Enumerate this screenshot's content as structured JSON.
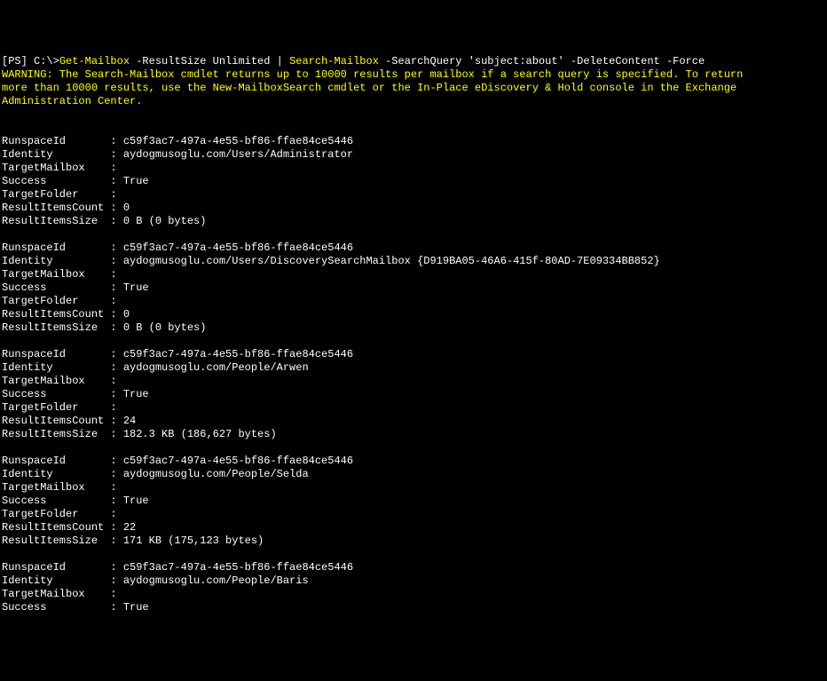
{
  "prompt_prefix": "[PS] C:\\>",
  "cmd1": "Get-Mailbox",
  "cmd_args1": " -ResultSize Unlimited | ",
  "cmd2": "Search-Mailbox",
  "cmd_args2": " -SearchQuery 'subject:about' -DeleteContent -Force",
  "warning_l1": "WARNING: The Search-Mailbox cmdlet returns up to 10000 results per mailbox if a search query is specified. To return",
  "warning_l2": "more than 10000 results, use the New-MailboxSearch cmdlet or the In-Place eDiscovery & Hold console in the Exchange",
  "warning_l3": "Administration Center.",
  "records": [
    {
      "RunspaceId": "c59f3ac7-497a-4e55-bf86-ffae84ce5446",
      "Identity": "aydogmusoglu.com/Users/Administrator",
      "TargetMailbox": "",
      "Success": "True",
      "TargetFolder": "",
      "ResultItemsCount": "0",
      "ResultItemsSize": "0 B (0 bytes)"
    },
    {
      "RunspaceId": "c59f3ac7-497a-4e55-bf86-ffae84ce5446",
      "Identity": "aydogmusoglu.com/Users/DiscoverySearchMailbox {D919BA05-46A6-415f-80AD-7E09334BB852}",
      "TargetMailbox": "",
      "Success": "True",
      "TargetFolder": "",
      "ResultItemsCount": "0",
      "ResultItemsSize": "0 B (0 bytes)"
    },
    {
      "RunspaceId": "c59f3ac7-497a-4e55-bf86-ffae84ce5446",
      "Identity": "aydogmusoglu.com/People/Arwen",
      "TargetMailbox": "",
      "Success": "True",
      "TargetFolder": "",
      "ResultItemsCount": "24",
      "ResultItemsSize": "182.3 KB (186,627 bytes)"
    },
    {
      "RunspaceId": "c59f3ac7-497a-4e55-bf86-ffae84ce5446",
      "Identity": "aydogmusoglu.com/People/Selda",
      "TargetMailbox": "",
      "Success": "True",
      "TargetFolder": "",
      "ResultItemsCount": "22",
      "ResultItemsSize": "171 KB (175,123 bytes)"
    }
  ],
  "partial": {
    "RunspaceId": "c59f3ac7-497a-4e55-bf86-ffae84ce5446",
    "Identity": "aydogmusoglu.com/People/Baris",
    "TargetMailbox": "",
    "Success": "True"
  },
  "labels": {
    "RunspaceId": "RunspaceId",
    "Identity": "Identity",
    "TargetMailbox": "TargetMailbox",
    "Success": "Success",
    "TargetFolder": "TargetFolder",
    "ResultItemsCount": "ResultItemsCount",
    "ResultItemsSize": "ResultItemsSize"
  }
}
